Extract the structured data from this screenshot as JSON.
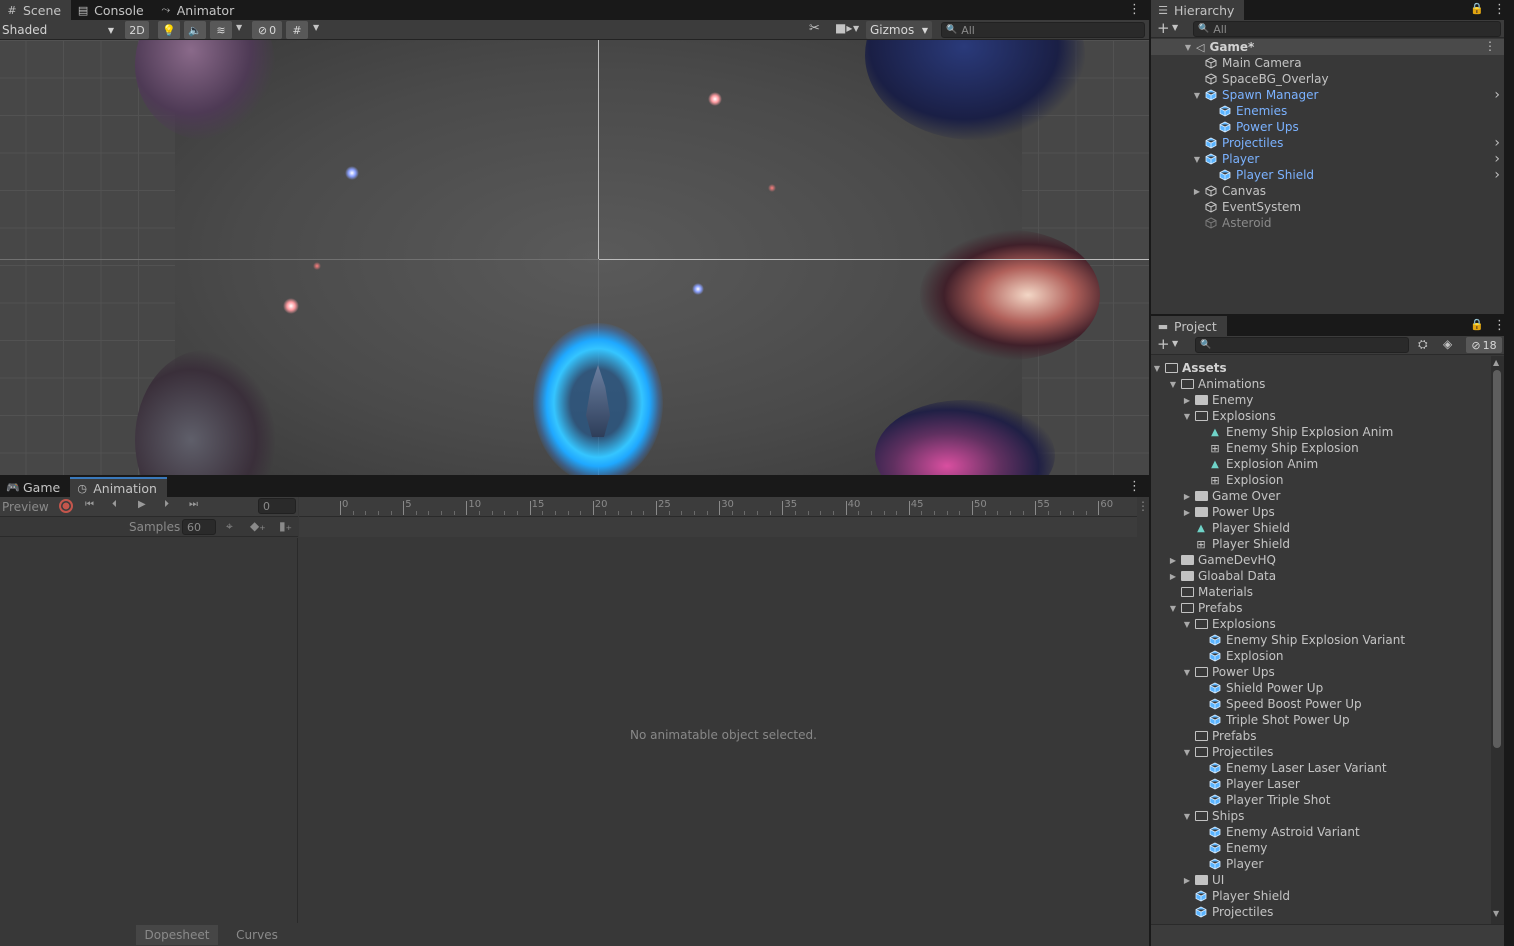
{
  "scene_tabs": [
    {
      "label": "Scene",
      "icon": "hash-icon",
      "active": true
    },
    {
      "label": "Console",
      "icon": "console-icon",
      "active": false
    },
    {
      "label": "Animator",
      "icon": "animator-icon",
      "active": false
    }
  ],
  "scene_toolbar": {
    "shading": "Shaded",
    "mode_2d": "2D",
    "hidden_count": "0",
    "gizmos": "Gizmos",
    "search_placeholder": "All"
  },
  "hierarchy": {
    "tab_label": "Hierarchy",
    "search_placeholder": "All",
    "scene_name": "Game*",
    "items": [
      {
        "label": "Main Camera",
        "depth": 1,
        "style": "normal",
        "arrow": ""
      },
      {
        "label": "SpaceBG_Overlay",
        "depth": 1,
        "style": "normal",
        "arrow": ""
      },
      {
        "label": "Spawn Manager",
        "depth": 1,
        "style": "prefab",
        "arrow": "▼",
        "chevron": true
      },
      {
        "label": "Enemies",
        "depth": 2,
        "style": "prefab",
        "arrow": ""
      },
      {
        "label": "Power Ups",
        "depth": 2,
        "style": "prefab",
        "arrow": ""
      },
      {
        "label": "Projectiles",
        "depth": 1,
        "style": "prefab",
        "arrow": "",
        "chevron": true
      },
      {
        "label": "Player",
        "depth": 1,
        "style": "prefab",
        "arrow": "▼",
        "chevron": true
      },
      {
        "label": "Player Shield",
        "depth": 2,
        "style": "prefab",
        "arrow": "",
        "chevron": true
      },
      {
        "label": "Canvas",
        "depth": 1,
        "style": "normal",
        "arrow": "▶"
      },
      {
        "label": "EventSystem",
        "depth": 1,
        "style": "normal",
        "arrow": ""
      },
      {
        "label": "Asteroid",
        "depth": 1,
        "style": "disabled",
        "arrow": ""
      }
    ]
  },
  "project": {
    "tab_label": "Project",
    "hidden_count": "18",
    "root": "Assets",
    "items": [
      {
        "label": "Animations",
        "depth": 1,
        "type": "folder-open",
        "arrow": "▼"
      },
      {
        "label": "Enemy",
        "depth": 2,
        "type": "folder",
        "arrow": "▶"
      },
      {
        "label": "Explosions",
        "depth": 2,
        "type": "folder-open",
        "arrow": "▼"
      },
      {
        "label": "Enemy Ship Explosion Anim",
        "depth": 3,
        "type": "anim",
        "arrow": ""
      },
      {
        "label": "Enemy Ship Explosion",
        "depth": 3,
        "type": "controller",
        "arrow": ""
      },
      {
        "label": "Explosion Anim",
        "depth": 3,
        "type": "anim",
        "arrow": ""
      },
      {
        "label": "Explosion",
        "depth": 3,
        "type": "controller",
        "arrow": ""
      },
      {
        "label": "Game Over",
        "depth": 2,
        "type": "folder",
        "arrow": "▶"
      },
      {
        "label": "Power Ups",
        "depth": 2,
        "type": "folder",
        "arrow": "▶"
      },
      {
        "label": "Player Shield",
        "depth": 2,
        "type": "anim",
        "arrow": ""
      },
      {
        "label": "Player Shield",
        "depth": 2,
        "type": "controller",
        "arrow": ""
      },
      {
        "label": "GameDevHQ",
        "depth": 1,
        "type": "folder",
        "arrow": "▶"
      },
      {
        "label": "Gloabal Data",
        "depth": 1,
        "type": "folder",
        "arrow": "▶"
      },
      {
        "label": "Materials",
        "depth": 1,
        "type": "folder-empty",
        "arrow": ""
      },
      {
        "label": "Prefabs",
        "depth": 1,
        "type": "folder-open",
        "arrow": "▼"
      },
      {
        "label": "Explosions",
        "depth": 2,
        "type": "folder-open",
        "arrow": "▼"
      },
      {
        "label": "Enemy Ship Explosion Variant",
        "depth": 3,
        "type": "variant",
        "arrow": ""
      },
      {
        "label": "Explosion",
        "depth": 3,
        "type": "prefab",
        "arrow": ""
      },
      {
        "label": "Power Ups",
        "depth": 2,
        "type": "folder-open",
        "arrow": "▼"
      },
      {
        "label": "Shield Power Up",
        "depth": 3,
        "type": "prefab",
        "arrow": ""
      },
      {
        "label": "Speed Boost Power Up",
        "depth": 3,
        "type": "prefab",
        "arrow": ""
      },
      {
        "label": "Triple Shot Power Up",
        "depth": 3,
        "type": "prefab",
        "arrow": ""
      },
      {
        "label": "Prefabs",
        "depth": 2,
        "type": "folder-empty",
        "arrow": ""
      },
      {
        "label": "Projectiles",
        "depth": 2,
        "type": "folder-open",
        "arrow": "▼"
      },
      {
        "label": "Enemy Laser Laser Variant",
        "depth": 3,
        "type": "variant",
        "arrow": ""
      },
      {
        "label": "Player Laser",
        "depth": 3,
        "type": "prefab",
        "arrow": ""
      },
      {
        "label": "Player Triple Shot",
        "depth": 3,
        "type": "prefab",
        "arrow": ""
      },
      {
        "label": "Ships",
        "depth": 2,
        "type": "folder-open",
        "arrow": "▼"
      },
      {
        "label": "Enemy Astroid Variant",
        "depth": 3,
        "type": "variant",
        "arrow": ""
      },
      {
        "label": "Enemy",
        "depth": 3,
        "type": "prefab",
        "arrow": ""
      },
      {
        "label": "Player",
        "depth": 3,
        "type": "prefab",
        "arrow": ""
      },
      {
        "label": "UI",
        "depth": 2,
        "type": "folder",
        "arrow": "▶"
      },
      {
        "label": "Player Shield",
        "depth": 2,
        "type": "prefab",
        "arrow": ""
      },
      {
        "label": "Projectiles",
        "depth": 2,
        "type": "prefab",
        "arrow": ""
      }
    ]
  },
  "bottom_tabs": [
    {
      "label": "Game",
      "icon": "gamepad-icon",
      "active": false
    },
    {
      "label": "Animation",
      "icon": "clock-icon",
      "active": true
    }
  ],
  "animation": {
    "preview_label": "Preview",
    "frame_value": "0",
    "samples_label": "Samples",
    "samples_value": "60",
    "ruler_ticks": [
      "0",
      "5",
      "10",
      "15",
      "20",
      "25",
      "30",
      "35",
      "40",
      "45",
      "50",
      "55",
      "60"
    ],
    "empty_message": "No animatable object selected.",
    "dopesheet_label": "Dopesheet",
    "curves_label": "Curves"
  },
  "colors": {
    "accent": "#3a79bb",
    "prefab_blue": "#7bb2ff",
    "shield_cyan": "#33ccff",
    "panel_bg": "#383838",
    "dark_bg": "#191919"
  }
}
